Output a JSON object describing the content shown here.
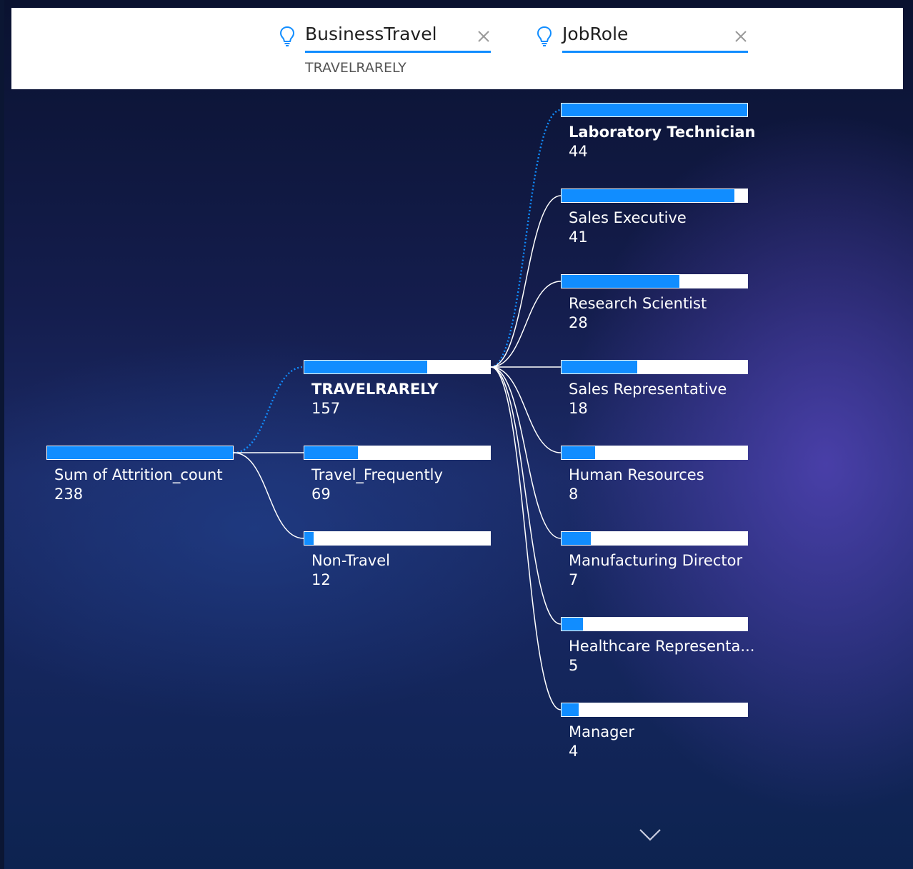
{
  "levels": [
    {
      "title": "BusinessTravel",
      "selected": "TRAVELRARELY",
      "icon": "lightbulb-icon"
    },
    {
      "title": "JobRole",
      "selected": "",
      "icon": "lightbulb-icon"
    }
  ],
  "tree": {
    "root": {
      "label": "Sum of Attrition_count",
      "value": 238
    },
    "business_travel": [
      {
        "label": "TRAVELRARELY",
        "value": 157,
        "selected": true
      },
      {
        "label": "Travel_Frequently",
        "value": 69
      },
      {
        "label": "Non-Travel",
        "value": 12
      }
    ],
    "job_role": [
      {
        "label": "Laboratory Technician",
        "value": 44,
        "selected": true
      },
      {
        "label": "Sales Executive",
        "value": 41
      },
      {
        "label": "Research Scientist",
        "value": 28
      },
      {
        "label": "Sales Representative",
        "value": 18
      },
      {
        "label": "Human Resources",
        "value": 8
      },
      {
        "label": "Manufacturing Director",
        "value": 7
      },
      {
        "label": "Healthcare Representa...",
        "value": 5
      },
      {
        "label": "Manager",
        "value": 4
      }
    ]
  },
  "colors": {
    "bar": "#118dff",
    "track": "#ffffff",
    "connector": "#ffffff"
  }
}
